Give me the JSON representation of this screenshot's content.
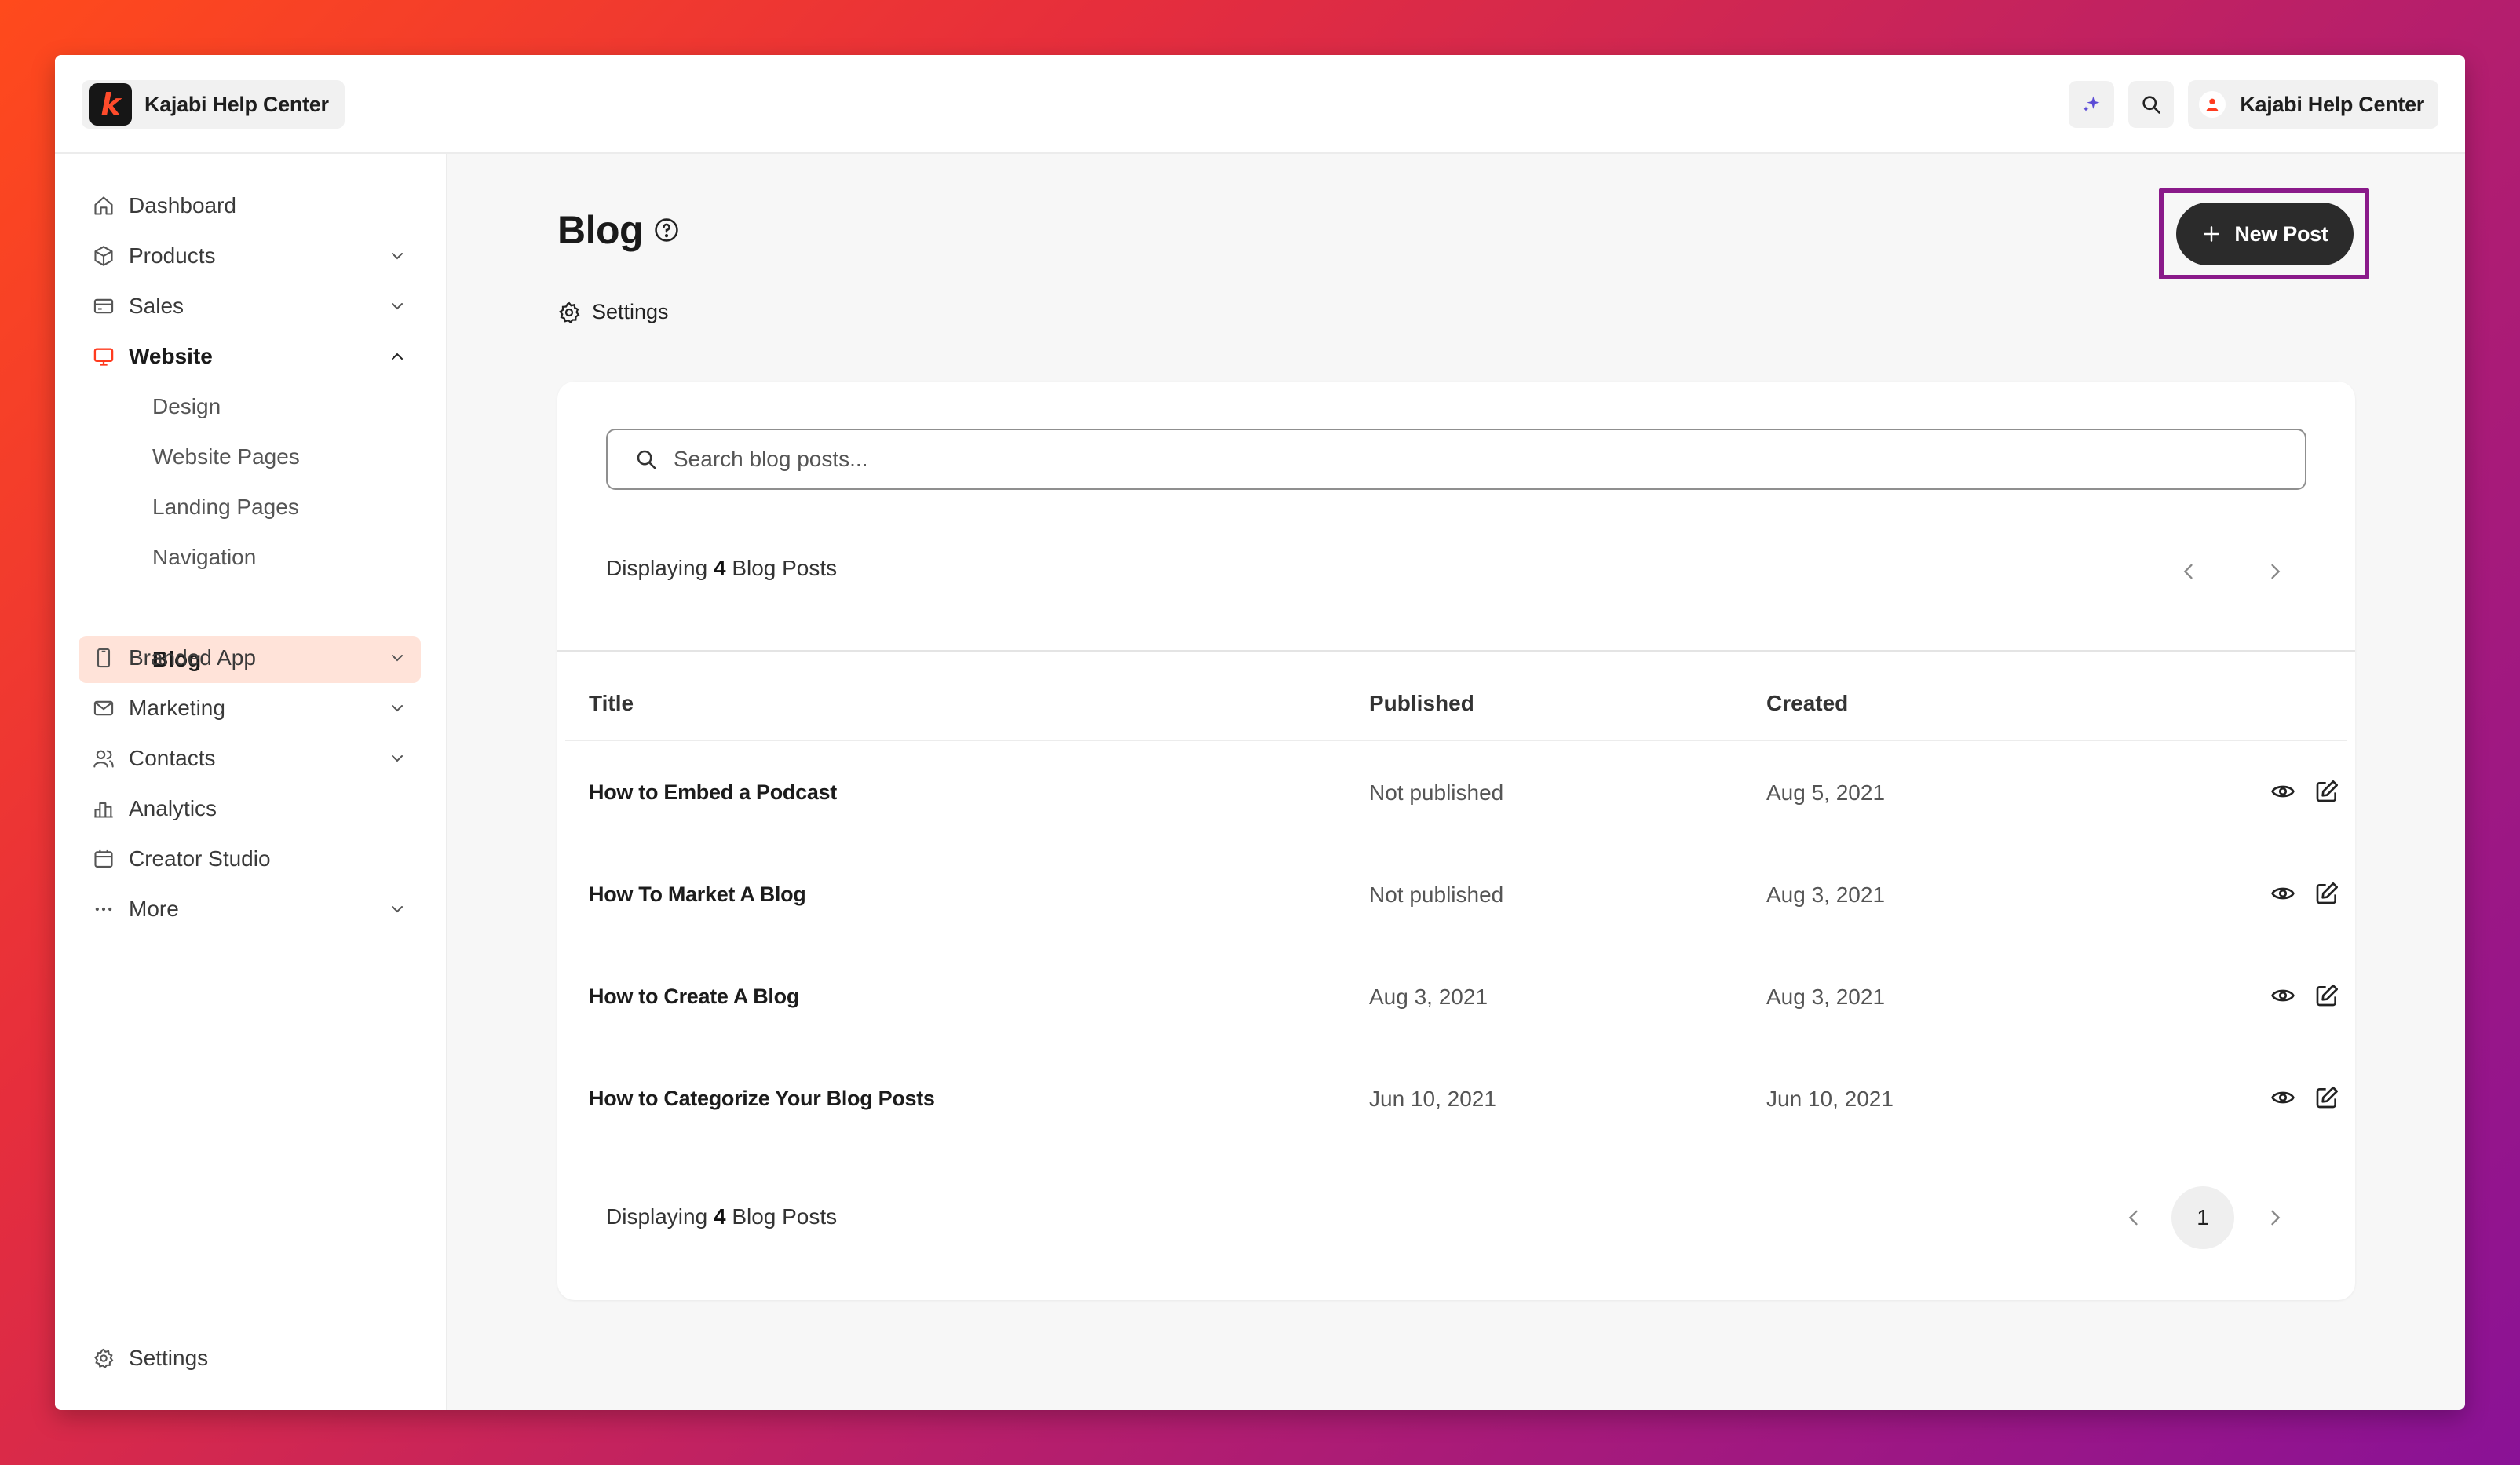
{
  "app": {
    "name": "Kajabi Help Center",
    "user_name": "Kajabi Help Center"
  },
  "icons": {
    "logo": "kajabi-logo",
    "ai": "sparkle-icon",
    "search": "search-icon",
    "user": "user-icon"
  },
  "colors": {
    "accent": "#ff4b2b",
    "selected_bg": "#ffe3d9",
    "primary_button": "#2b2b2b",
    "highlight_border": "#8a1a8a"
  },
  "sidebar": {
    "items": [
      {
        "label": "Dashboard"
      },
      {
        "label": "Products"
      },
      {
        "label": "Sales"
      },
      {
        "label": "Website"
      },
      {
        "label": "Branded App"
      },
      {
        "label": "Marketing"
      },
      {
        "label": "Contacts"
      },
      {
        "label": "Analytics"
      },
      {
        "label": "Creator Studio"
      },
      {
        "label": "More"
      }
    ],
    "website_sub": [
      {
        "label": "Design"
      },
      {
        "label": "Website Pages"
      },
      {
        "label": "Landing Pages"
      },
      {
        "label": "Navigation"
      },
      {
        "label": "Blog"
      }
    ],
    "settings_label": "Settings"
  },
  "main": {
    "title": "Blog",
    "settings_label": "Settings",
    "new_post_label": "New Post",
    "search_placeholder": "Search blog posts...",
    "display_prefix": "Displaying",
    "display_count": "4",
    "display_suffix": "Blog Posts",
    "columns": [
      "Title",
      "Published",
      "Created"
    ],
    "rows": [
      {
        "title": "How to Embed a Podcast",
        "published": "Not published",
        "created": "Aug 5, 2021"
      },
      {
        "title": "How To Market A Blog",
        "published": "Not published",
        "created": "Aug 3, 2021"
      },
      {
        "title": "How to Create A Blog",
        "published": "Aug 3, 2021",
        "created": "Aug 3, 2021"
      },
      {
        "title": "How to Categorize Your Blog Posts",
        "published": "Jun 10, 2021",
        "created": "Jun 10, 2021"
      }
    ],
    "current_page": "1"
  }
}
